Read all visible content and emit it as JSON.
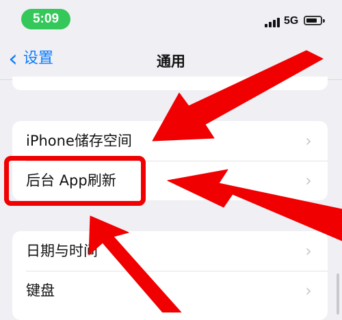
{
  "status_bar": {
    "time": "5:09",
    "network": "5G"
  },
  "navigation": {
    "back_label": "设置",
    "title": "通用"
  },
  "settings": {
    "group1": [
      "iPhone储存空间",
      "后台 App刷新"
    ],
    "group2": [
      "日期与时间",
      "键盘"
    ]
  },
  "icons": {
    "back": "chevron-left-icon",
    "row": "chevron-right-icon",
    "signal": "signal-icon",
    "battery": "battery-icon"
  },
  "colors": {
    "time_pill": "#34c759",
    "accent": "#0a7cff",
    "annotation": "#f00000",
    "background": "#efeff4"
  }
}
